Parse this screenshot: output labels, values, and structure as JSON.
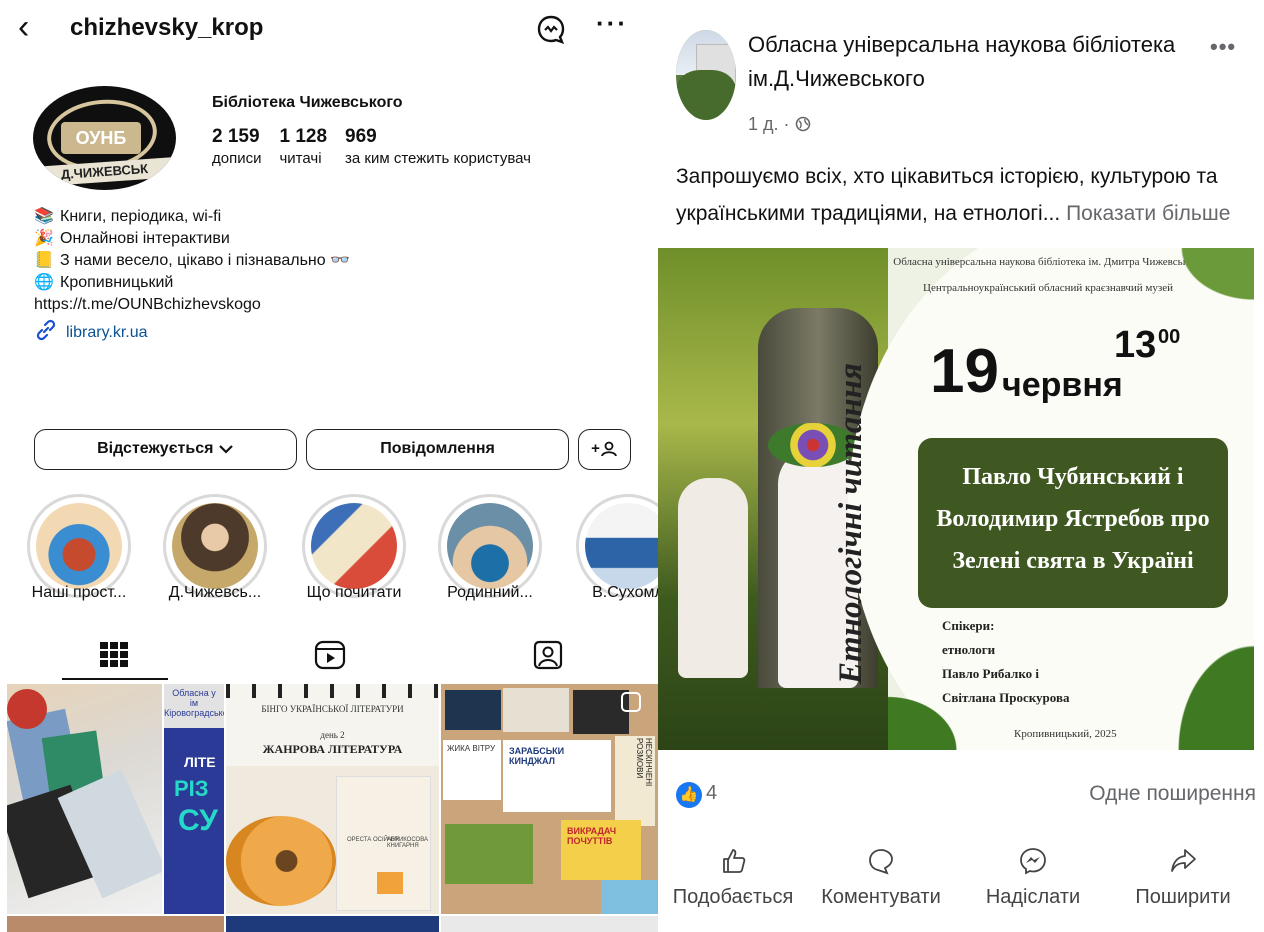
{
  "instagram": {
    "username": "chizhevsky_krop",
    "profile_name": "Бібліотека Чижевського",
    "avatar_text": {
      "badge": "ОУНБ",
      "ribbon": "Д.ЧИЖЕВСЬК"
    },
    "stats": [
      {
        "num": "2 159",
        "label": "дописи"
      },
      {
        "num": "1 128",
        "label": "читачі"
      },
      {
        "num": "969",
        "label": "за ким стежить користувач"
      }
    ],
    "bio": [
      {
        "icon": "📚",
        "text": "Книги, періодика, wi-fi"
      },
      {
        "icon": "🎉",
        "text": "Онлайнові інтерактиви"
      },
      {
        "icon": "📒",
        "text": "З нами весело, цікаво і пізнавально 👓"
      },
      {
        "icon": "🌐",
        "text": "Кропивницький"
      },
      {
        "icon": "",
        "text": "https://t.me/OUNBchizhevskogo"
      }
    ],
    "link": "library.kr.ua",
    "buttons": {
      "follow": "Відстежується",
      "message": "Повідомлення",
      "add_user": "+"
    },
    "highlights": [
      "Наші прост...",
      "Д.Чижевсь...",
      "Що почитати",
      "Родинний...",
      "В.Сухомл"
    ],
    "grid_texts": {
      "t2_top": "Обласна у",
      "t2_mid1": "ім",
      "t2_mid2": "Кіровоградське",
      "t2_big": "ЛІТЕ",
      "t2_big2": "РІЗ",
      "t2_big3": "СУ",
      "t3_line1": "БІНГО УКРАЇНСЬКОЇ ЛІТЕРАТУРИ",
      "t3_line2": "день 2",
      "t3_line3": "ЖАНРОВА ЛІТЕРАТУРА",
      "t3_book1": "ОРЕСТА ОСІЙЧУК",
      "t3_book2": "АБРИКОСОВА КНИГАРНЯ",
      "t4_book1": "ЗАРАБСЬКИ КИНДЖАЛ",
      "t4_book2": "НЕСКІНЧЕНІ РОЗМОВИ",
      "t4_book3": "ВИКРАДАЧ ПОЧУТТІВ",
      "t4_book4": "ЖИКА ВІТРУ"
    }
  },
  "facebook": {
    "page_name": "Обласна універсальна наукова бібліотека ім.Д.Чижевського",
    "meta": "1 д. · ",
    "post_text": "Запрошуємо всіх, хто цікавиться історією, культурою та українськими традиціями, на етнологі...",
    "show_more": "Показати більше",
    "poster": {
      "org1": "Обласна універсальна наукова бібліотека ім. Дмитра Чижевського",
      "org2": "Центральноукраїнський обласний краєзнавчий музей",
      "side_title": "Етнологічні читання",
      "day": "19",
      "month": "червня",
      "hour": "13",
      "minutes": "00",
      "topic_l1": "Павло Чубинський і",
      "topic_l2": "Володимир Ястребов про",
      "topic_l3": "Зелені свята в Україні",
      "speakers_l1": "Спікери:",
      "speakers_l2": "етнологи",
      "speakers_l3": "Павло Рибалко і",
      "speakers_l4": "Світлана Проскурова",
      "footer": "Кропивницький, 2025"
    },
    "likes": "4",
    "shares": "Одне поширення",
    "actions": [
      "Подобається",
      "Коментувати",
      "Надіслати",
      "Поширити"
    ],
    "colors": {
      "accent": "#1877f2",
      "poster_green": "#3f5821"
    }
  }
}
